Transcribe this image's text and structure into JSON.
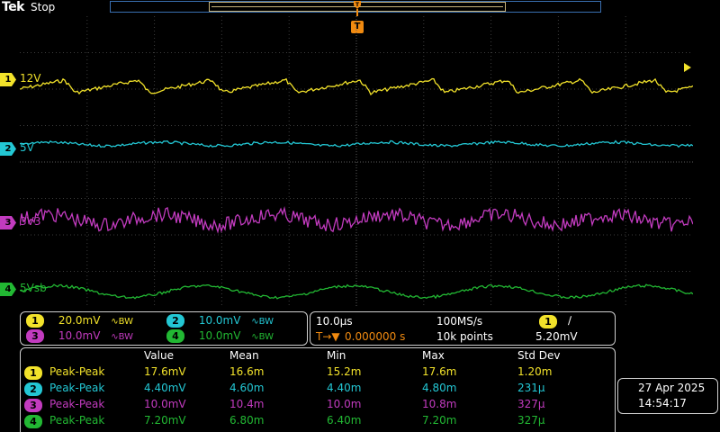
{
  "header": {
    "brand": "Tek",
    "run_state": "Stop",
    "trigger_marker": "T"
  },
  "channels": [
    {
      "num": "1",
      "label": "12V",
      "color": "#f2e22a",
      "scale": "20.0mV"
    },
    {
      "num": "2",
      "label": "5V",
      "color": "#23c7d4",
      "scale": "10.0mV"
    },
    {
      "num": "3",
      "label": "3V3",
      "color": "#c23bbf",
      "scale": "10.0mV"
    },
    {
      "num": "4",
      "label": "5Vsb",
      "color": "#22b833",
      "scale": "10.0mV"
    }
  ],
  "bandwidth_symbol": "∿BW",
  "timebase": {
    "scale": "10.0µs",
    "sample_rate": "100MS/s",
    "trigger_pos_prefix": "T→▼",
    "trigger_pos": "0.000000 s",
    "record_length": "10k points",
    "trigger_channel": "1",
    "trigger_slope": "∕",
    "trigger_level": "5.20mV"
  },
  "measurements": {
    "headers": [
      "Value",
      "Mean",
      "Min",
      "Max",
      "Std Dev"
    ],
    "rows": [
      {
        "ch": "1",
        "name": "Peak-Peak",
        "value": "17.6mV",
        "mean": "16.6m",
        "min": "15.2m",
        "max": "17.6m",
        "std": "1.20m"
      },
      {
        "ch": "2",
        "name": "Peak-Peak",
        "value": "4.40mV",
        "mean": "4.60m",
        "min": "4.40m",
        "max": "4.80m",
        "std": "231µ"
      },
      {
        "ch": "3",
        "name": "Peak-Peak",
        "value": "10.0mV",
        "mean": "10.4m",
        "min": "10.0m",
        "max": "10.8m",
        "std": "327µ"
      },
      {
        "ch": "4",
        "name": "Peak-Peak",
        "value": "7.20mV",
        "mean": "6.80m",
        "min": "6.40m",
        "max": "7.20m",
        "std": "327µ"
      }
    ]
  },
  "datetime": {
    "date": "27 Apr  2025",
    "time": "14:54:17"
  }
}
